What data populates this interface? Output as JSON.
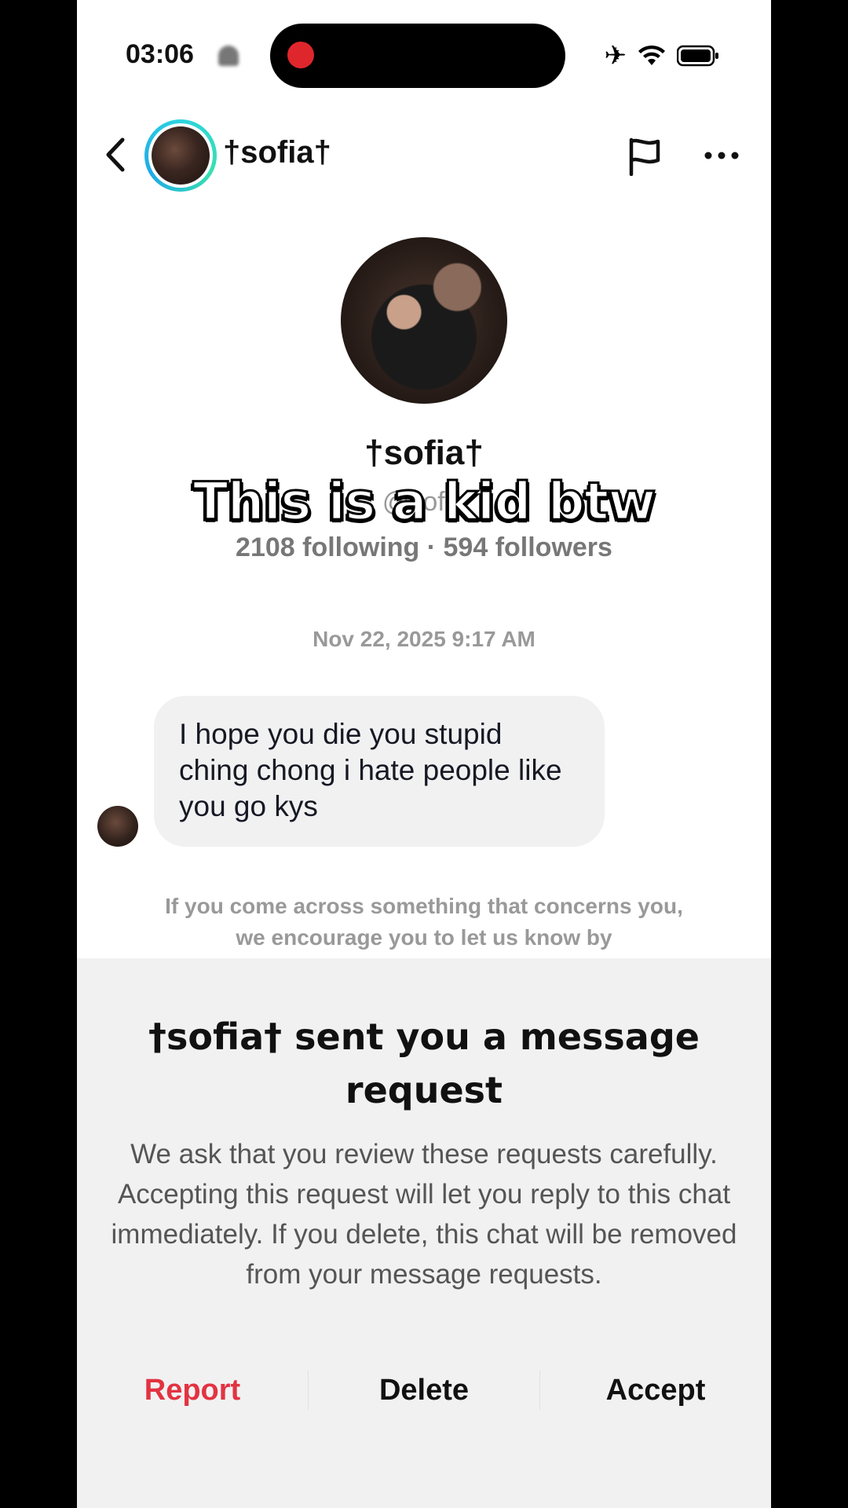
{
  "status_bar": {
    "time": "03:06"
  },
  "header": {
    "name": "†sofia†",
    "icons": {
      "back": "chevron-left-icon",
      "report": "flag-icon",
      "more": "more-horizontal-icon"
    }
  },
  "profile": {
    "name": "†sofia†",
    "handle": "@sofia",
    "stats": "2108 following · 594 followers"
  },
  "overlay": {
    "caption": "This is a kid btw"
  },
  "conversation": {
    "timestamp": "Nov 22, 2025 9:17 AM",
    "messages": [
      {
        "text": "I hope you die you stupid ching chong i hate people like you go kys"
      }
    ],
    "safety_note": "If you come across something that concerns you, we encourage you to let us know by"
  },
  "sheet": {
    "title": "†sofia† sent you a message request",
    "body": "We ask that you review these requests carefully. Accepting this request will let you reply to this chat immediately. If you delete, this chat will be removed from your message requests.",
    "actions": {
      "report": "Report",
      "delete": "Delete",
      "accept": "Accept"
    }
  },
  "colors": {
    "report_red": "#e23341",
    "record_dot": "#e0262d",
    "ring_accent": "#2dd4e0"
  }
}
